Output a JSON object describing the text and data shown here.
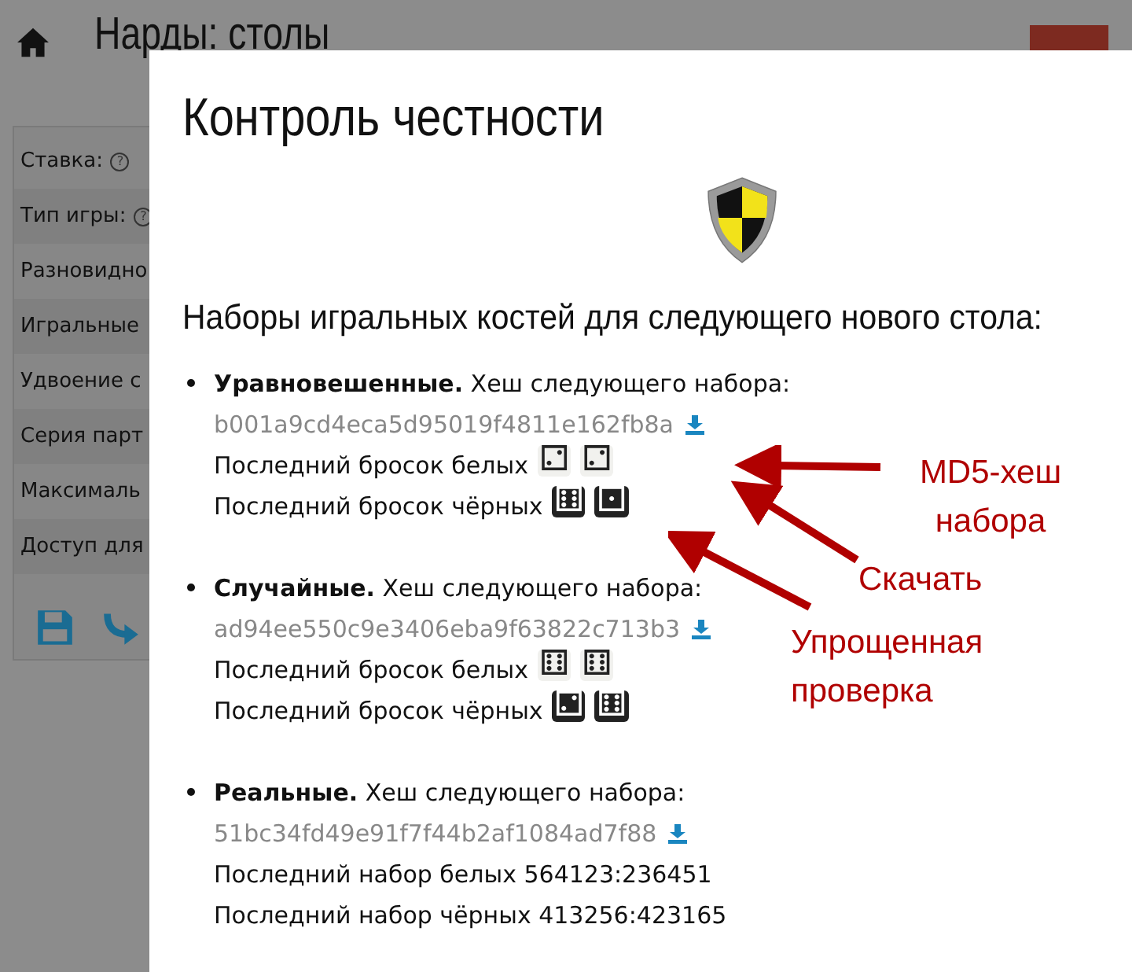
{
  "page": {
    "title": "Нарды: столы"
  },
  "settings_rows": [
    {
      "label": "Ставка:",
      "help_icon": "?"
    },
    {
      "label": "Тип игры:",
      "help_icon": "?"
    },
    {
      "label": "Разновидно"
    },
    {
      "label": "Игральные"
    },
    {
      "label": "Удвоение с"
    },
    {
      "label": "Серия парт"
    },
    {
      "label": "Максималь"
    },
    {
      "label": "Доступ для"
    }
  ],
  "modal": {
    "title": "Контроль честности",
    "heading": "Наборы игральных костей для следующего нового стола:",
    "sets": [
      {
        "caption": "**Уравновешенные.** Хеш следующего набора:",
        "hash": "b001a9cd4eca5d95019f4811e162fb8a",
        "lines": [
          {
            "kind": "white_dice",
            "label": "Последний бросок белых",
            "dice": [
              "⚁",
              "⚁"
            ]
          },
          {
            "kind": "black_dice",
            "label": "Последний бросок чёрных",
            "dice": [
              "⚅",
              "⚀"
            ]
          }
        ]
      },
      {
        "caption": "**Случайные.** Хеш следующего набора:",
        "hash": "ad94ee550c9e3406eba9f63822c713b3",
        "lines": [
          {
            "kind": "white_dice",
            "label": "Последний бросок белых",
            "dice": [
              "⚅",
              "⚅"
            ]
          },
          {
            "kind": "black_dice",
            "label": "Последний бросок чёрных",
            "dice": [
              "⚁",
              "⚅"
            ]
          }
        ]
      },
      {
        "caption": "**Реальные.** Хеш следующего набора:",
        "hash": "51bc34fd49e91f7f44b2af1084ad7f88",
        "lines": [
          {
            "kind": "text",
            "label": "Последний набор белых 564123:236451"
          },
          {
            "kind": "text",
            "label": "Последний набор чёрных 413256:423165"
          }
        ]
      }
    ]
  },
  "annotations": [
    {
      "text": "MD5-хеш набора"
    },
    {
      "text": "Скачать"
    },
    {
      "text": "Упрощенная проверка"
    }
  ]
}
